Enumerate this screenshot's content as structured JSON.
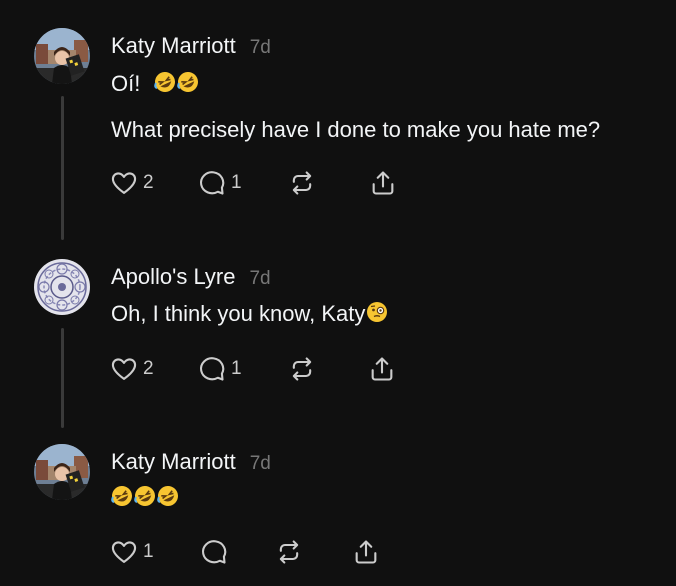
{
  "colors": {
    "background": "#101010",
    "text": "#f3f5f7",
    "muted": "#777777",
    "icon": "#cccccc",
    "thread_line": "#3a3a3a",
    "emoji_yellow": "#f7c531"
  },
  "posts": [
    {
      "author": "Katy Marriott",
      "time": "7d",
      "lines": [
        "Oí!",
        "What precisely have I done to make you hate me?"
      ],
      "emoji": [
        "rolling-on-floor-laughing",
        "rolling-on-floor-laughing"
      ],
      "likes": "2",
      "replies": "1",
      "actions": [
        "heart-icon",
        "comment-icon",
        "repost-icon",
        "share-icon"
      ]
    },
    {
      "author": "Apollo's Lyre",
      "time": "7d",
      "lines": [
        "Oh, I think you know, Katy"
      ],
      "emoji": [
        "face-with-raised-eyebrow-monocle"
      ],
      "likes": "2",
      "replies": "1",
      "actions": [
        "heart-icon",
        "comment-icon",
        "repost-icon",
        "share-icon"
      ]
    },
    {
      "author": "Katy Marriott",
      "time": "7d",
      "lines": [],
      "emoji": [
        "rolling-on-floor-laughing",
        "rolling-on-floor-laughing",
        "rolling-on-floor-laughing"
      ],
      "likes": "1",
      "replies": "",
      "actions": [
        "heart-icon",
        "comment-icon",
        "repost-icon",
        "share-icon"
      ]
    }
  ]
}
